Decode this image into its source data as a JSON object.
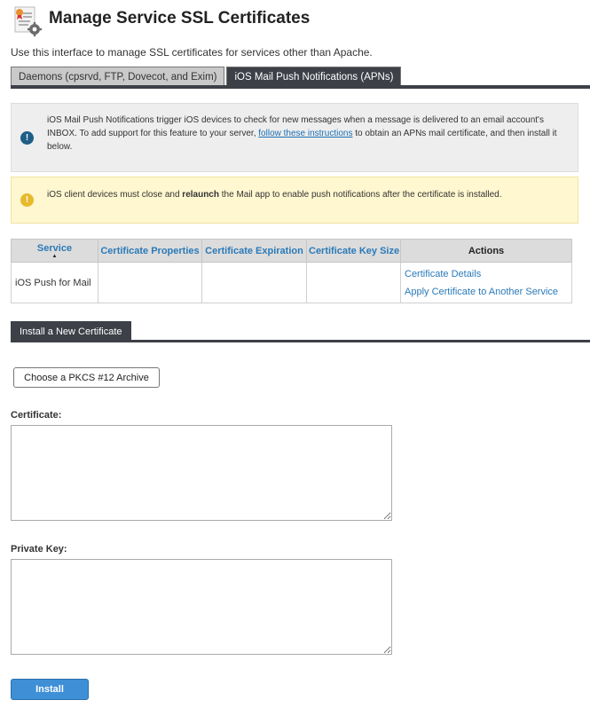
{
  "header": {
    "icon": "ssl-certificate-gear-icon",
    "title": "Manage Service SSL Certificates",
    "intro": "Use this interface to manage SSL certificates for services other than Apache."
  },
  "tabs": [
    {
      "label": "Daemons (cpsrvd, FTP, Dovecot, and Exim)",
      "active": false
    },
    {
      "label": "iOS Mail Push Notifications (APNs)",
      "active": true
    }
  ],
  "info_alert": {
    "icon": "info-icon",
    "text_before": "iOS Mail Push Notifications trigger iOS devices to check for new messages when a message is delivered to an email account's INBOX. To add support for this feature to your server, ",
    "link_text": "follow these instructions",
    "text_after": " to obtain an APNs mail certificate, and then install it below."
  },
  "warning_alert": {
    "icon": "warning-icon",
    "text_before": "iOS client devices must close and ",
    "emphasis": "relaunch",
    "text_after": " the Mail app to enable push notifications after the certificate is installed."
  },
  "table": {
    "headers": [
      "Service",
      "Certificate Properties",
      "Certificate Expiration",
      "Certificate Key Size",
      "Actions"
    ],
    "sort_indicator": "▲",
    "rows": [
      {
        "service": "iOS Push for Mail",
        "properties": "",
        "expiration": "",
        "key_size": "",
        "actions": [
          "Certificate Details",
          "Apply Certificate to Another Service"
        ]
      }
    ]
  },
  "install": {
    "tab_label": "Install a New Certificate",
    "pkcs_button": "Choose a PKCS #12 Archive",
    "certificate_label": "Certificate:",
    "certificate_value": "",
    "private_key_label": "Private Key:",
    "private_key_value": "",
    "submit_label": "Install"
  },
  "colors": {
    "tab_dark": "#3d4047",
    "link": "#2a7ab8",
    "primary_button": "#3e8fd6",
    "info_icon": "#1e5e87",
    "warning_icon": "#e7b92c"
  }
}
